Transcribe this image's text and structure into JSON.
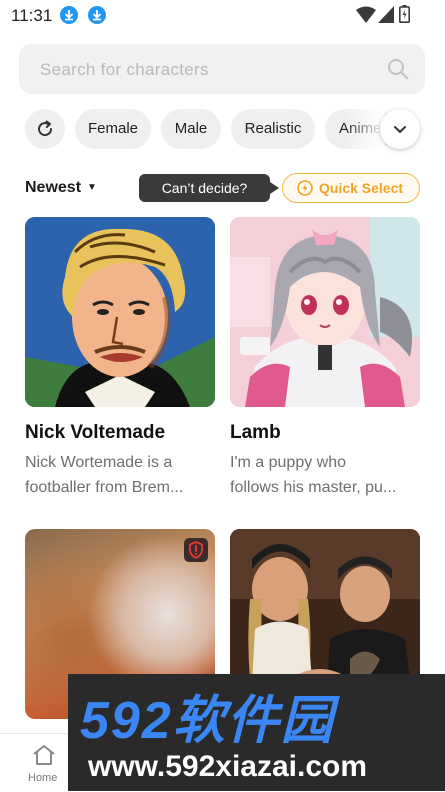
{
  "status_bar": {
    "time": "11:31"
  },
  "search": {
    "placeholder": "Search for characters"
  },
  "filters": [
    "Female",
    "Male",
    "Realistic",
    "Anime"
  ],
  "sort": {
    "label": "Newest"
  },
  "tooltip": {
    "text": "Can’t decide?"
  },
  "quick_select": {
    "label": "Quick Select"
  },
  "cards": [
    {
      "name": "Nick Voltemade",
      "desc_line1": "Nick Wortemade is a",
      "desc_line2": "footballer from Brem..."
    },
    {
      "name": "Lamb",
      "desc_line1": "I'm a puppy who",
      "desc_line2": "follows his master, pu..."
    }
  ],
  "bottom_nav": {
    "home_label": "Home"
  },
  "watermark": {
    "top": "592软件园",
    "bottom": "www.592xiazai.com"
  },
  "colors": {
    "accent": "#f2a325",
    "chip_bg": "#efefef",
    "watermark_blue": "#3a86f2"
  }
}
